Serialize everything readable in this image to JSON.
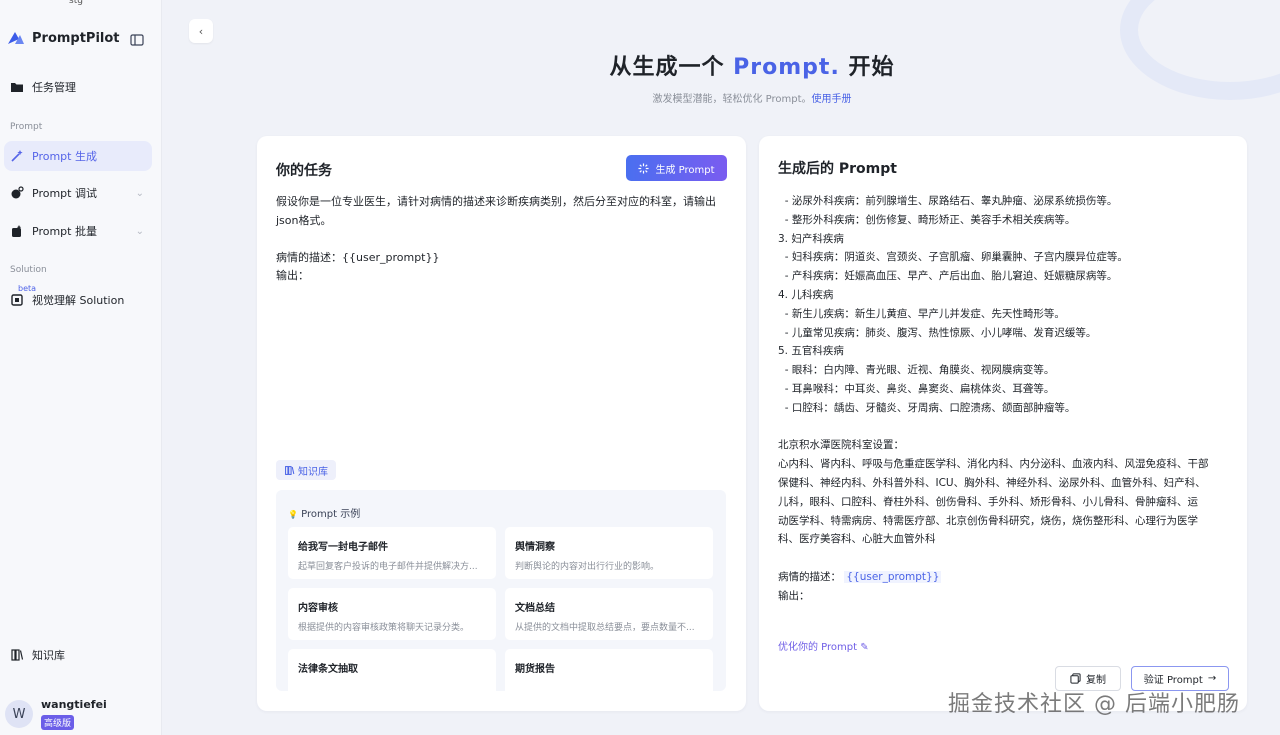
{
  "env": "stg",
  "app": {
    "name": "PromptPilot"
  },
  "sidebar": {
    "task_management": "任务管理",
    "section_prompt": "Prompt",
    "prompt_generate": "Prompt 生成",
    "prompt_debug": "Prompt 调试",
    "prompt_batch": "Prompt 批量",
    "section_solution": "Solution",
    "beta": "beta",
    "visual_solution": "视觉理解 Solution",
    "knowledge_base": "知识库"
  },
  "user": {
    "initial": "W",
    "name": "wangtiefei",
    "plan": "高级版"
  },
  "hero": {
    "title_prefix": "从生成一个 ",
    "title_accent": "Prompt.",
    "title_suffix": " 开始",
    "subtitle": "激发模型潜能，轻松优化 Prompt。",
    "manual_link": "使用手册"
  },
  "task_panel": {
    "title": "你的任务",
    "generate_button": "生成 Prompt",
    "content": "假设你是一位专业医生，请针对病情的描述来诊断疾病类别，然后分至对应的科室，请输出\njson格式。\n\n病情的描述：{{user_prompt}}\n输出：",
    "kb_chip": "知识库",
    "examples_title": "Prompt 示例",
    "examples": [
      {
        "title": "给我写一封电子邮件",
        "desc": "起草回复客户投诉的电子邮件并提供解决方..."
      },
      {
        "title": "舆情洞察",
        "desc": "判断舆论的内容对出行行业的影响。"
      },
      {
        "title": "内容审核",
        "desc": "根据提供的内容审核政策将聊天记录分类。"
      },
      {
        "title": "文档总结",
        "desc": "从提供的文档中提取总结要点，要点数量不..."
      },
      {
        "title": "法律条文抽取",
        "desc": ""
      },
      {
        "title": "期货报告",
        "desc": ""
      }
    ]
  },
  "result_panel": {
    "title": "生成后的 Prompt",
    "content": "  - 泌尿外科疾病：前列腺增生、尿路结石、睾丸肿瘤、泌尿系统损伤等。\n  - 整形外科疾病：创伤修复、畸形矫正、美容手术相关疾病等。\n3. 妇产科疾病\n  - 妇科疾病：阴道炎、宫颈炎、子宫肌瘤、卵巢囊肿、子宫内膜异位症等。\n  - 产科疾病：妊娠高血压、早产、产后出血、胎儿窘迫、妊娠糖尿病等。\n4. 儿科疾病\n  - 新生儿疾病：新生儿黄疸、早产儿并发症、先天性畸形等。\n  - 儿童常见疾病：肺炎、腹泻、热性惊厥、小儿哮喘、发育迟缓等。\n5. 五官科疾病\n  - 眼科：白内障、青光眼、近视、角膜炎、视网膜病变等。\n  - 耳鼻喉科：中耳炎、鼻炎、鼻窦炎、扁桃体炎、耳聋等。\n  - 口腔科：龋齿、牙髓炎、牙周病、口腔溃疡、颌面部肿瘤等。\n\n北京积水潭医院科室设置：\n心内科、肾内科、呼吸与危重症医学科、消化内科、内分泌科、血液内科、风湿免疫科、干部\n保健科、神经内科、外科普外科、ICU、胸外科、神经外科、泌尿外科、血管外科、妇产科、\n儿科，眼科、口腔科、脊柱外科、创伤骨科、手外科、矫形骨科、小儿骨科、骨肿瘤科、运\n动医学科、特需病房、特需医疗部、北京创伤骨科研究，烧伤，烧伤整形科、心理行为医学\n科、医疗美容科、心脏大血管外科\n\n",
    "desc_label": "病情的描述： ",
    "var": "{{user_prompt}}",
    "output_label": "输出：",
    "optimize_link": "优化你的 Prompt",
    "copy_button": "复制",
    "verify_button": "验证 Prompt"
  },
  "watermark": "掘金技术社区 @ 后端小肥肠"
}
